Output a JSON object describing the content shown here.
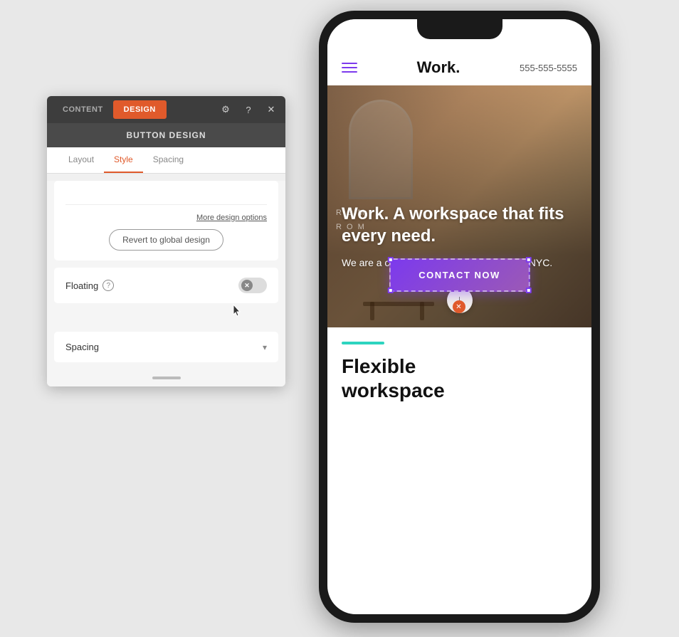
{
  "panel": {
    "tab_content": "CONTENT",
    "tab_design": "DESIGN",
    "title": "BUTTON DESIGN",
    "subtab_layout": "Layout",
    "subtab_style": "Style",
    "subtab_spacing": "Spacing",
    "design_options_link": "More design options",
    "revert_btn": "Revert to global design",
    "floating_label": "Floating",
    "floating_help": "?",
    "spacing_label": "Spacing",
    "icons": {
      "settings": "⚙",
      "help": "?",
      "close": "✕"
    }
  },
  "phone": {
    "logo": "Work.",
    "phone_number": "555-555-5555",
    "hero_title": "Work. A workspace that fits every need.",
    "hero_subtitle": "We are a coworking community located in NYC.",
    "cta_button": "CONTACT NOW",
    "room_text_line1": "R O M",
    "room_text_line2": "R O M",
    "below_heading_line1": "Flexible",
    "below_heading_line2": "workspace"
  }
}
